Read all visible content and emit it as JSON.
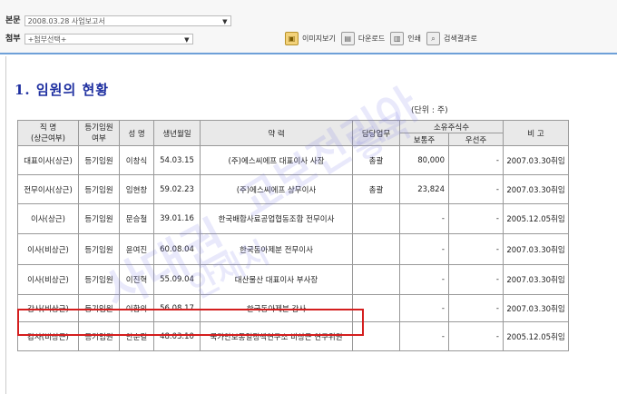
{
  "toolbar": {
    "doc_label": "본문",
    "doc_value": "2008.03.28  사업보고서",
    "attach_label": "첨부",
    "attach_value": "+첨부선택+",
    "view_image": "이미지보기",
    "download": "다운로드",
    "print": "인쇄",
    "search_results": "검색결과로"
  },
  "page": {
    "title": "1. 임원의 현황",
    "unit": "(단위 : 주)"
  },
  "table": {
    "headers": {
      "position": "직 명\n(상근여부)",
      "registered": "등기임원\n여부",
      "name": "성 명",
      "birth": "생년월일",
      "career": "약 력",
      "duty": "담당업무",
      "shares": "소유주식수",
      "common": "보통주",
      "preferred": "우선주",
      "note": "비 고"
    },
    "rows": [
      {
        "position": "대표이사(상근)",
        "registered": "등기임원",
        "name": "이창식",
        "birth": "54.03.15",
        "career": "(주)에스씨에프 대표이사 사장",
        "duty": "총괄",
        "common": "80,000",
        "preferred": "-",
        "note": "2007.03.30취임"
      },
      {
        "position": "전무이사(상근)",
        "registered": "등기임원",
        "name": "임현창",
        "birth": "59.02.23",
        "career": "(주)에스씨에프 상무이사",
        "duty": "총괄",
        "common": "23,824",
        "preferred": "-",
        "note": "2007.03.30취임"
      },
      {
        "position": "이사(상근)",
        "registered": "등기임원",
        "name": "문승철",
        "birth": "39.01.16",
        "career": "한국배합사료공업협동조합 전무이사",
        "duty": "",
        "common": "-",
        "preferred": "-",
        "note": "2005.12.05취임"
      },
      {
        "position": "이사(비상근)",
        "registered": "등기임원",
        "name": "윤여진",
        "birth": "60.08.04",
        "career": "한국동아제분 전무이사",
        "duty": "",
        "common": "-",
        "preferred": "-",
        "note": "2007.03.30취임"
      },
      {
        "position": "이사(비상근)",
        "registered": "등기임원",
        "name": "이진혁",
        "birth": "55.09.04",
        "career": "대산물산 대표이사 부사장",
        "duty": "",
        "common": "-",
        "preferred": "-",
        "note": "2007.03.30취임"
      },
      {
        "position": "감사(비상근)",
        "registered": "등기임원",
        "name": "이황의",
        "birth": "56.08.17",
        "career": "한국동아제분 감사",
        "duty": "",
        "common": "-",
        "preferred": "-",
        "note": "2007.03.30취임"
      },
      {
        "position": "감사(비상근)",
        "registered": "등기임원",
        "name": "안순길",
        "birth": "48.03.10",
        "career": "국가안보통일정책연구소 비상근 연구위원",
        "duty": "",
        "common": "-",
        "preferred": "-",
        "note": "2005.12.05취임"
      }
    ]
  },
  "watermark": {
    "line1": "사대권",
    "line2": "안재차",
    "line3": "교보전리아",
    "line4": "흥국"
  },
  "colors": {
    "title": "#1e2fa0",
    "highlight": "#d41e1e",
    "header_bg": "#e9e9e9",
    "top_line": "#6ea0d8"
  }
}
